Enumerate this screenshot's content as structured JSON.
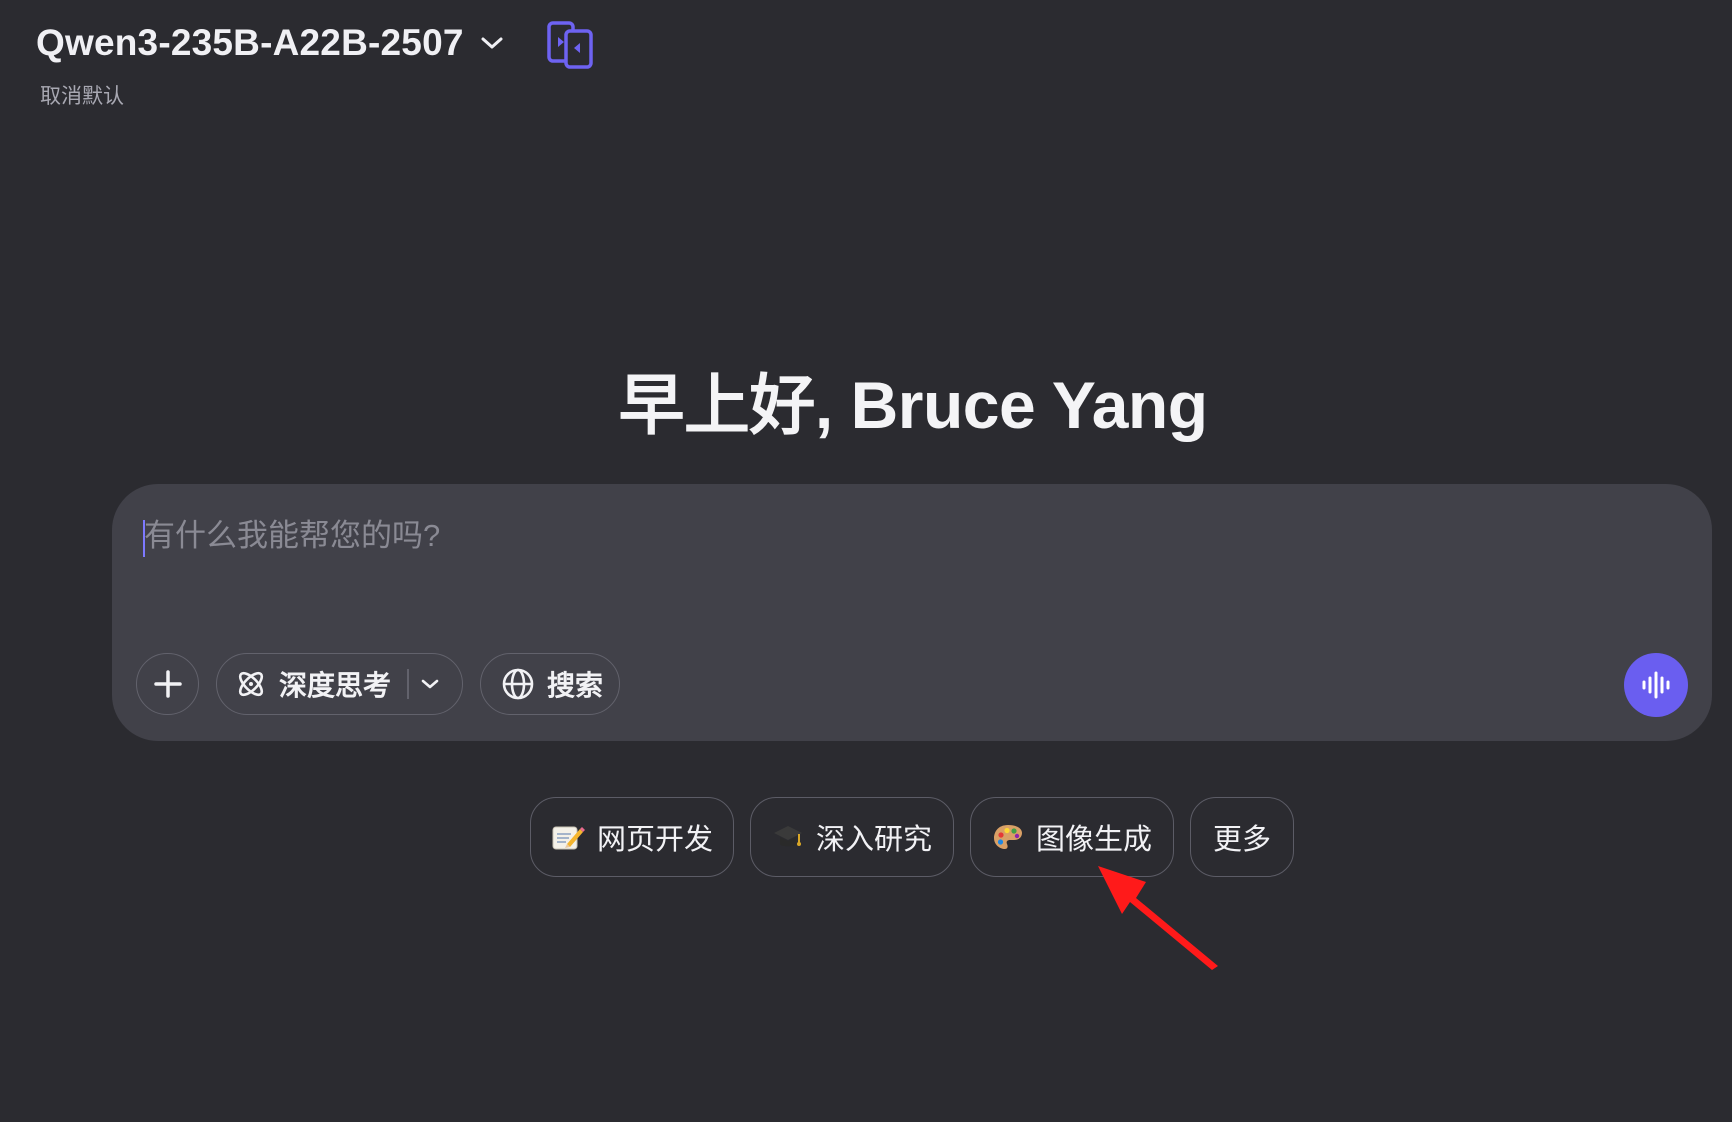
{
  "header": {
    "model_name": "Qwen3-235B-A22B-2507",
    "unset_default_label": "取消默认"
  },
  "greeting": "早上好, Bruce Yang",
  "composer": {
    "placeholder": "有什么我能帮您的吗?",
    "value": "",
    "deep_think_label": "深度思考",
    "search_label": "搜索"
  },
  "suggestions": [
    {
      "label": "网页开发",
      "icon": "memo-pencil-icon"
    },
    {
      "label": "深入研究",
      "icon": "graduation-cap-icon"
    },
    {
      "label": "图像生成",
      "icon": "artist-palette-icon"
    },
    {
      "label": "更多"
    }
  ],
  "annotation": {
    "type": "red-arrow",
    "target": "图像生成",
    "color": "#ff1a1a"
  },
  "colors": {
    "background": "#2b2b30",
    "composer_bg": "#414149",
    "accent": "#6a5ef0",
    "compare_icon": "#6e63f2"
  }
}
